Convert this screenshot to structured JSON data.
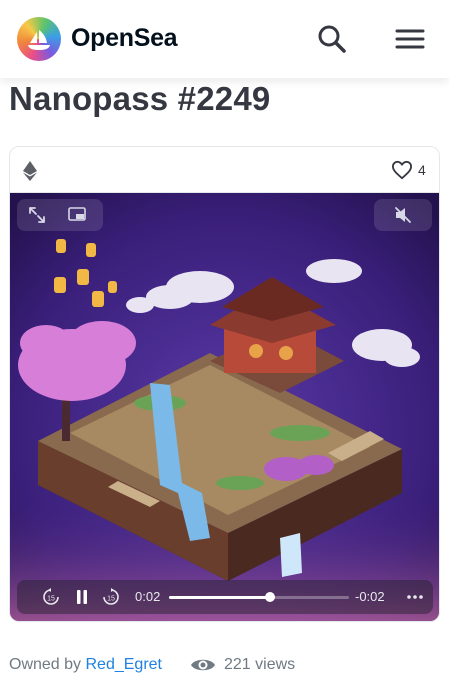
{
  "header": {
    "brand": "OpenSea",
    "logo_icon": "opensea-logo",
    "search_icon": "search-icon",
    "menu_icon": "hamburger-menu-icon"
  },
  "item": {
    "title": "Nanopass #2249",
    "chain_icon": "ethereum-icon",
    "likes": "4"
  },
  "player": {
    "current_time": "0:02",
    "remaining_time": "-0:02",
    "progress": 0.56,
    "rewind_label": "15",
    "forward_label": "15"
  },
  "footer": {
    "owned_by_label": "Owned by",
    "owner": "Red_Egret",
    "views": "221 views"
  },
  "colors": {
    "brand_text": "#04111d",
    "link": "#2081e2",
    "muted": "#707a83",
    "scene_bg": "#3a1f7a"
  }
}
